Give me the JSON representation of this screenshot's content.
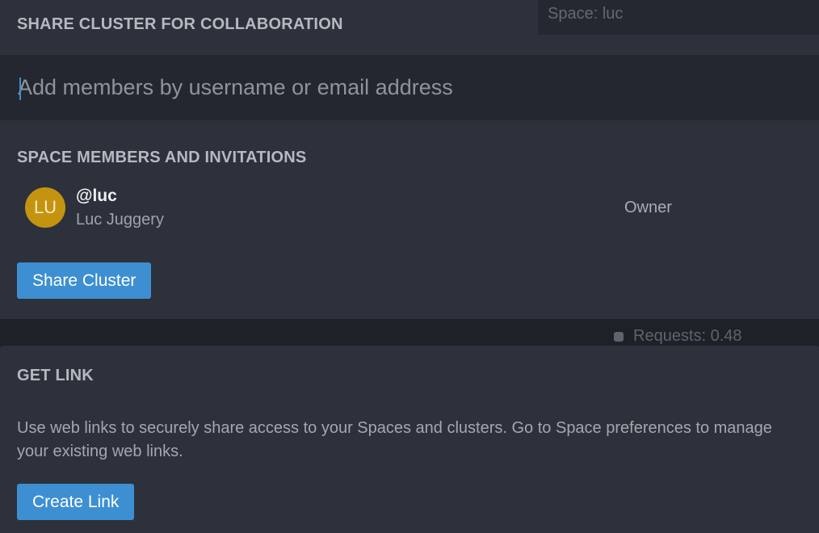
{
  "share_panel": {
    "title": "SHARE CLUSTER FOR COLLABORATION",
    "space_indicator": "Space: luc",
    "member_input": {
      "placeholder": "Add members by username or email address",
      "value": ""
    },
    "members_title": "SPACE MEMBERS AND INVITATIONS",
    "members": [
      {
        "initials": "LU",
        "username": "@luc",
        "name": "Luc Juggery",
        "role": "Owner",
        "avatar_color": "#c49410"
      }
    ],
    "share_button_label": "Share Cluster"
  },
  "background": {
    "requests_label": "Requests: 0.48"
  },
  "link_panel": {
    "title": "GET LINK",
    "description": "Use web links to securely share access to your Spaces and clusters. Go to Space preferences to manage your existing web links.",
    "create_button_label": "Create Link"
  },
  "colors": {
    "accent": "#3d8fd1",
    "panel_bg": "#2d313b",
    "input_bg": "#24272f"
  }
}
